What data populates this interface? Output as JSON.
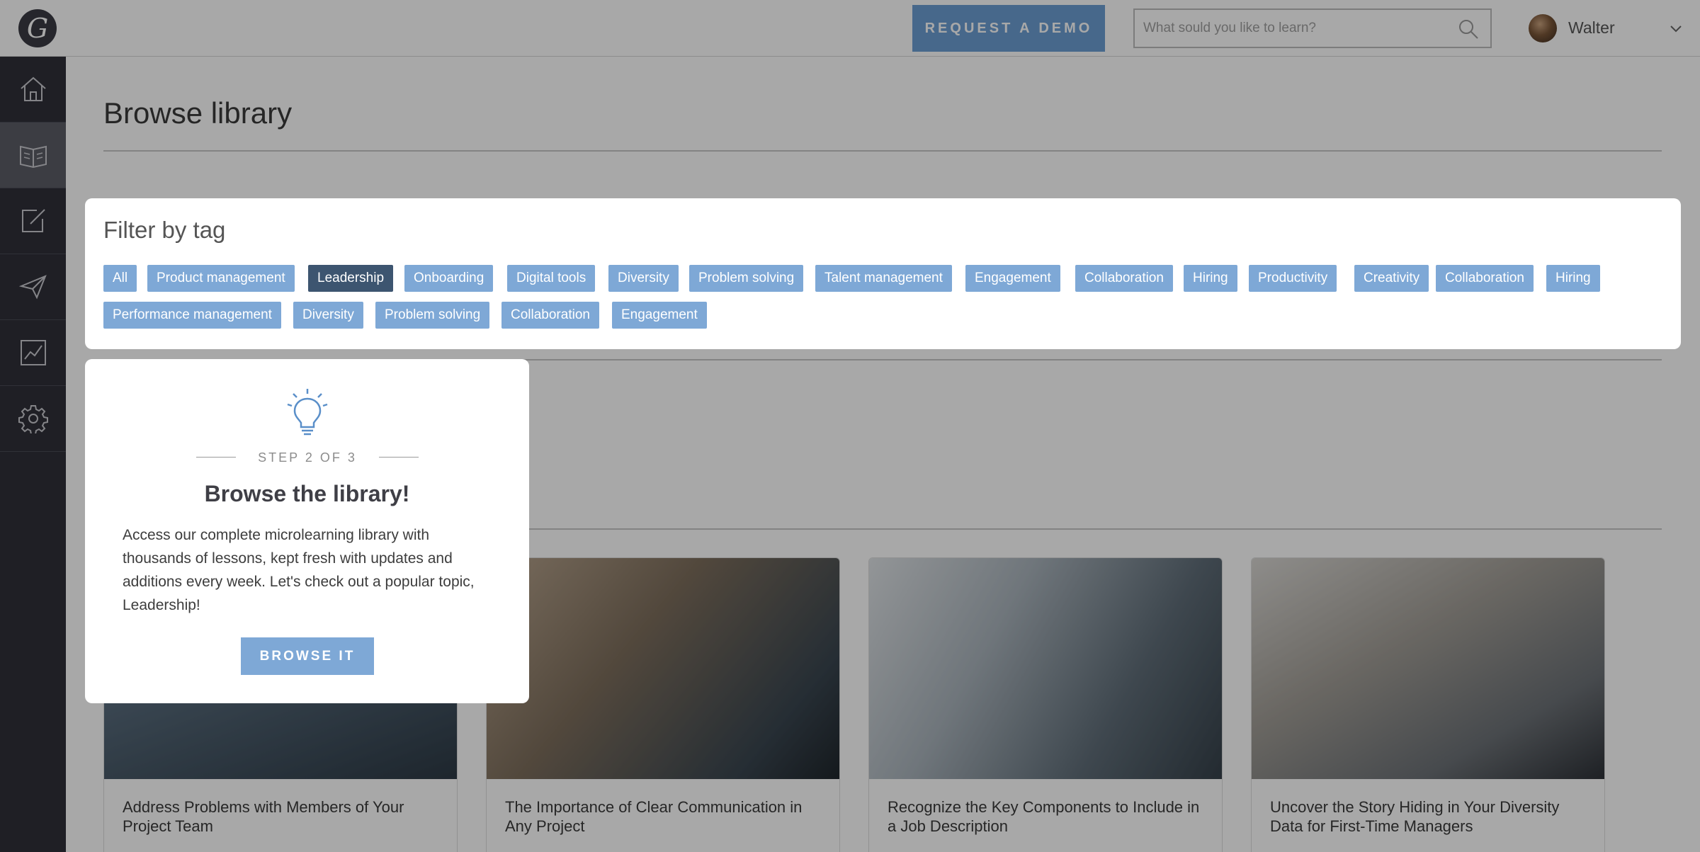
{
  "topbar": {
    "logo_letter": "G",
    "demo_button": "REQUEST A DEMO",
    "search_placeholder": "What sould you like to learn?",
    "user_name": "Walter"
  },
  "sidebar": {
    "items": [
      {
        "icon": "home-icon"
      },
      {
        "icon": "library-book-icon",
        "active": true
      },
      {
        "icon": "edit-icon"
      },
      {
        "icon": "send-icon"
      },
      {
        "icon": "chart-icon"
      },
      {
        "icon": "gear-icon"
      }
    ]
  },
  "main": {
    "page_title": "Browse library"
  },
  "filter": {
    "title": "Filter by tag",
    "tags": [
      "All",
      "Product management",
      "Leadership",
      "Onboarding",
      "Digital tools",
      "Diversity",
      "Problem solving",
      "Talent management",
      "Engagement",
      "Collaboration",
      "Hiring",
      "Productivity",
      "Creativity",
      "Collaboration",
      "Hiring",
      "Performance management",
      "Diversity",
      "Problem solving",
      "Collaboration",
      "Engagement"
    ],
    "selected_tag": "Leadership"
  },
  "cards": [
    {
      "title": "Address Problems with Members of Your Project Team"
    },
    {
      "title": "The Importance of Clear Communication in Any Project"
    },
    {
      "title": "Recognize the Key Components to Include in a Job Description"
    },
    {
      "title": "Uncover the Story Hiding in Your Diversity Data for First-Time Managers"
    }
  ],
  "popover": {
    "step": "STEP 2 OF 3",
    "title": "Browse the library!",
    "body": "Access our complete microlearning library with thousands of lessons, kept fresh with updates and additions every week. Let's check out a popular topic, Leadership!",
    "button": "BROWSE IT"
  }
}
